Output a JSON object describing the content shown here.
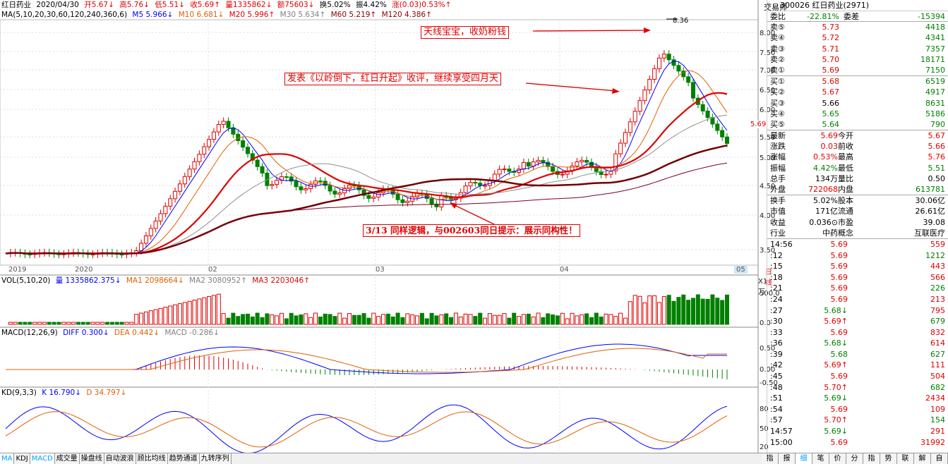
{
  "header": {
    "stock_name": "红日药业",
    "date": "2020/04/30",
    "open": "开5.67↓",
    "high": "高5.76↓",
    "low": "低5.51↓",
    "close": "收5.69↑",
    "volume": "量1335862↓",
    "amount": "额75603↓",
    "turnover": "换5.02%",
    "amplitude": "振4.42%",
    "change": "涨(0.03)0.53%↑"
  },
  "ma_line": {
    "label": "MA(5,10,20,30,60,120,240,360,6)",
    "m5": "M5 5.966↓",
    "m10": "M10 6.681↓",
    "m20": "M20 5.996↑",
    "m30": "M30 5.634↑",
    "m60": "M60 5.219↑",
    "m120": "M120 4.386↑"
  },
  "price_axis": [
    "8.00",
    "7.50",
    "7.00",
    "6.50",
    "6.00",
    "5.50",
    "5.00",
    "4.50",
    "4.00",
    "3.50"
  ],
  "price_axis_current": "5.69",
  "peak_label": "8.36",
  "date_axis": [
    "2019",
    "2020",
    "02",
    "03",
    "04",
    "05"
  ],
  "annotations": {
    "a1": "天线宝宝，收奶粉钱",
    "a2": "发表《以岭倒下，红日升起》收评，继续享受四月天",
    "a3": "3/13 同样逻辑，与002603同日提示：展示同构性！"
  },
  "vol": {
    "label": "VOL(5,10,20)",
    "v": "量 1335862.375↓",
    "ma1": "MA1 2098664↓",
    "ma2": "MA2 3080952↑",
    "ma3": "MA3 2203046↑",
    "axis": [
      "X1万",
      "500.0",
      "0.0"
    ]
  },
  "macd": {
    "label": "MACD(12,26,9)",
    "diff": "DIFF 0.300↓",
    "dea": "DEA 0.442↓",
    "macd": "MACD -0.286↓",
    "axis": [
      "0.50",
      "0.00",
      "-0.50"
    ]
  },
  "kd": {
    "label": "KD(9,3,3)",
    "k": "K 16.790↓",
    "d": "D 34.797↓",
    "axis": [
      "80",
      "50",
      "20"
    ]
  },
  "tabs": [
    "MA",
    "KDJ",
    "MACD",
    "成交量",
    "操盘线",
    "自动波浪",
    "顾比均线",
    "趋势通道",
    "九转序列"
  ],
  "right_tabs": [
    "指",
    "报",
    "细",
    "笔",
    "价",
    "分",
    "指",
    "势",
    "联",
    "解",
    "自"
  ],
  "day_line_label": "日线",
  "side": {
    "top_label": "交易师",
    "badge": "R",
    "title": "300026 红日药业(2971)",
    "weibi_label": "委比",
    "weibi": "-22.81%",
    "weicha_label": "委差",
    "weicha": "-15394",
    "sell": [
      {
        "label": "卖⑤",
        "price": "5.73",
        "vol": "4418"
      },
      {
        "label": "卖④",
        "price": "5.72",
        "vol": "4341"
      },
      {
        "label": "卖③",
        "price": "5.71",
        "vol": "7357"
      },
      {
        "label": "卖②",
        "price": "5.70",
        "vol": "18171"
      },
      {
        "label": "卖①",
        "price": "5.69",
        "vol": "7150"
      }
    ],
    "buy": [
      {
        "label": "买①",
        "price": "5.68",
        "vol": "6519"
      },
      {
        "label": "买②",
        "price": "5.67",
        "vol": "4917"
      },
      {
        "label": "买③",
        "price": "5.66",
        "vol": "8631"
      },
      {
        "label": "买④",
        "price": "5.65",
        "vol": "5186"
      },
      {
        "label": "买⑤",
        "price": "5.64",
        "vol": "790"
      }
    ],
    "stats1": [
      [
        "最新",
        "5.69",
        "今开",
        "5.67"
      ],
      [
        "涨跌",
        "0.03",
        "前收",
        "5.66"
      ],
      [
        "涨幅",
        "0.53%",
        "最高",
        "5.76"
      ],
      [
        "振幅",
        "4.42%",
        "最低",
        "5.51"
      ],
      [
        "总手",
        "134万",
        "量比",
        "0.50"
      ],
      [
        "外盘",
        "722068",
        "内盘",
        "613781"
      ]
    ],
    "stats2": [
      [
        "换手",
        "5.02%",
        "股本",
        "30.06亿"
      ],
      [
        "市值",
        "171亿",
        "流通",
        "26.61亿"
      ],
      [
        "收益",
        "0.036⊙",
        "市盈",
        "39.08"
      ],
      [
        "行业",
        "中药",
        "概念",
        "互联医疗"
      ]
    ],
    "ticks": [
      [
        "14:56",
        "5.69",
        "559"
      ],
      [
        ":12",
        "5.69",
        "1212"
      ],
      [
        ":15",
        "5.69",
        "443"
      ],
      [
        ":18",
        "5.69",
        "566"
      ],
      [
        ":21",
        "5.69",
        "226"
      ],
      [
        ":24",
        "5.69",
        "213"
      ],
      [
        ":27",
        "5.68↓",
        "795"
      ],
      [
        ":30",
        "5.69↑",
        "679"
      ],
      [
        ":33",
        "5.69",
        "832"
      ],
      [
        ":36",
        "5.68↓",
        "614"
      ],
      [
        ":39",
        "5.68",
        "627"
      ],
      [
        ":42",
        "5.69↑",
        "111"
      ],
      [
        ":45",
        "5.69",
        "504"
      ],
      [
        ":48",
        "5.70↑",
        "682"
      ],
      [
        ":51",
        "5.69↓",
        "2434"
      ],
      [
        ":54",
        "5.69",
        "109"
      ],
      [
        ":57",
        "5.70↑",
        "154"
      ],
      [
        "14:57",
        "5.69↓",
        "291"
      ],
      [
        "15:00",
        "5.69",
        "31992"
      ]
    ]
  }
}
